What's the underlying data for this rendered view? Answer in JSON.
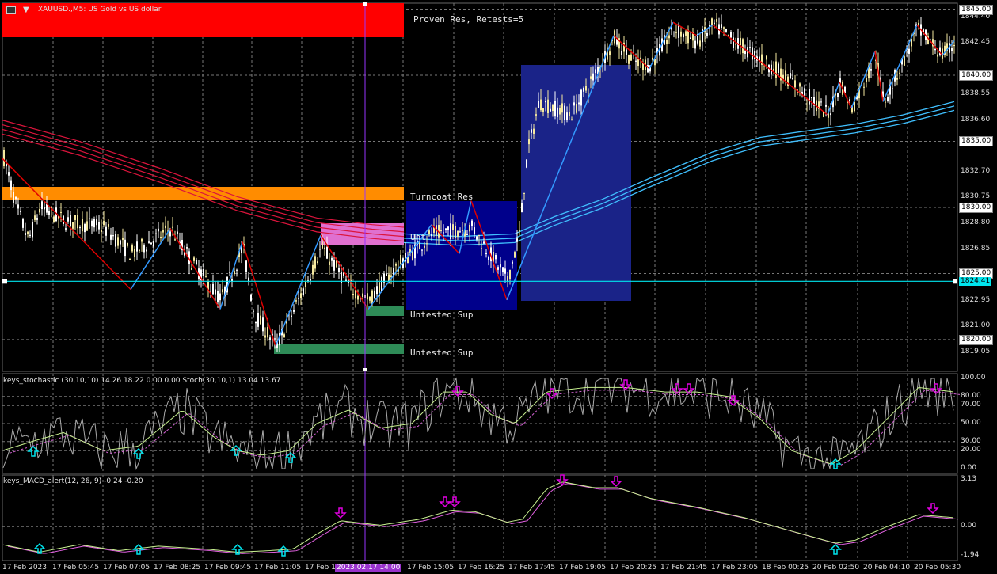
{
  "window": {
    "symbol_title": "XAUUSD.,M5: US Gold vs US dollar",
    "menu_icon": "window-menu-icon",
    "chart_icon": "chart-type-icon"
  },
  "zones": {
    "proven_res": "Proven Res, Retests=5",
    "turncoat_res": "Turncoat Res",
    "untested_sup_1": "Untested Sup",
    "untested_sup_2": "Untested Sup",
    "untested_res_partial": "Unt"
  },
  "price_axis": {
    "ticks": [
      "1844.40",
      "1842.45",
      "1838.55",
      "1836.60",
      "1832.70",
      "1830.75",
      "1828.80",
      "1826.85",
      "1822.95",
      "1821.00",
      "1819.05"
    ],
    "boxed": [
      "1845.00",
      "1840.00",
      "1835.00",
      "1830.00",
      "1825.00",
      "1820.00"
    ],
    "current_price": "1824.41"
  },
  "stochastic": {
    "title": "keys_stochastic (30,10,10) 14.26 18.22 0.00 0.00 Stoch(30,10,1) 13.04 13.67",
    "levels": [
      "100.00",
      "80.00",
      "70.00",
      "50.00",
      "30.00",
      "20.00",
      "0.00"
    ]
  },
  "macd": {
    "title": "keys_MACD_alert(12, 26, 9) -0.24 -0.20",
    "levels": [
      "3.13",
      "0.00",
      "-1.94"
    ]
  },
  "time_axis": {
    "labels": [
      "17 Feb 2023",
      "17 Feb 05:45",
      "17 Feb 07:05",
      "17 Feb 08:25",
      "17 Feb 09:45",
      "17 Feb 11:05",
      "17 Feb 1",
      "17 Feb 15:05",
      "17 Feb 16:25",
      "17 Feb 17:45",
      "17 Feb 19:05",
      "17 Feb 20:25",
      "17 Feb 21:45",
      "17 Feb 23:05",
      "18 Feb 00:25",
      "20 Feb 02:50",
      "20 Feb 04:10",
      "20 Feb 05:30"
    ],
    "crosshair_time": "2023.02.17 14:00"
  },
  "colors": {
    "background": "#000000",
    "bull_candle": "#f5e9a0",
    "bear_candle": "#ffffff",
    "zone_red": "#ff0000",
    "zone_orange": "#ff8c00",
    "zone_green": "#2e8b57",
    "zone_pink": "#e070d0",
    "zone_navy": "#00008b",
    "zigzag_up": "#3399ff",
    "zigzag_down": "#e00000",
    "ma_red": "#dc143c",
    "ma_cyan": "#40c0ff",
    "current_line": "#00e5ee",
    "crosshair": "#9933ff",
    "arrow_up": "#00e5ee",
    "arrow_down": "#e000e0"
  }
}
